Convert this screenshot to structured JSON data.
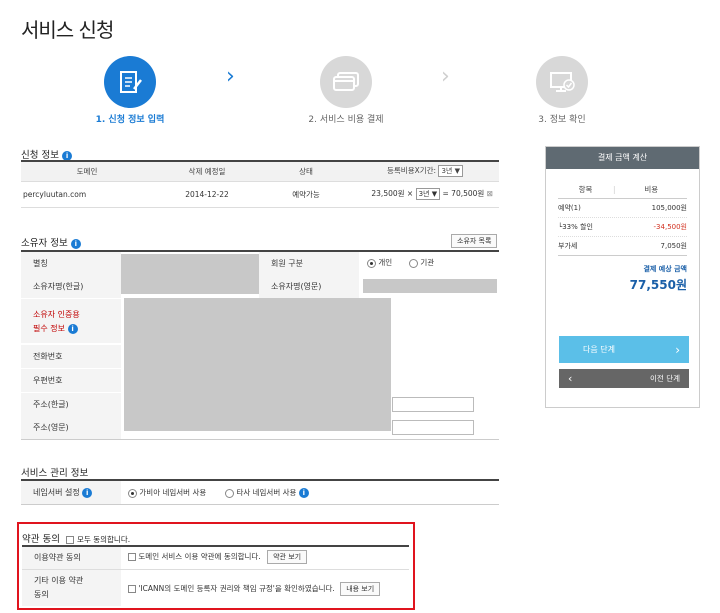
{
  "page": {
    "title": "서비스 신청"
  },
  "steps": [
    {
      "label": "1. 신청 정보 입력",
      "active": true
    },
    {
      "label": "2. 서비스 비용 결제",
      "active": false
    },
    {
      "label": "3. 정보 확인",
      "active": false
    }
  ],
  "application": {
    "title": "신청 정보",
    "headers": {
      "domain": "도메인",
      "deletion_date": "삭제 예정일",
      "status": "상태",
      "fee_period": "등록비용X기간:"
    },
    "header_period": "3년",
    "row": {
      "domain": "percyluutan.com",
      "deletion_date": "2014-12-22",
      "status": "예약가능",
      "unit_price": "23,500원 ×",
      "period": "3년",
      "total": "= 70,500원"
    }
  },
  "owner": {
    "title": "소유자 정보",
    "list_button": "소유자 목록",
    "labels": {
      "alias": "별칭",
      "member_type": "회원 구분",
      "name_kr": "소유자명(한글)",
      "name_en": "소유자명(영문)",
      "auth_line1": "소유자 인증용",
      "auth_line2": "필수 정보",
      "phone": "전화번호",
      "zip": "우편번호",
      "addr_kr": "주소(한글)",
      "addr_en": "주소(영문)"
    },
    "member_options": [
      "개인",
      "기관"
    ]
  },
  "service": {
    "title": "서비스 관리 정보",
    "nameserver_label": "네임서버 설정",
    "options": [
      "가비아 네임서버 사용",
      "타사 네임서버 사용"
    ]
  },
  "terms": {
    "title": "약관 동의",
    "agree_all": "모두 동의합니다.",
    "rows": [
      {
        "label": "이용약관 동의",
        "text": "도메인 서비스 이용 약관에 동의합니다.",
        "button": "약관 보기"
      },
      {
        "label_line1": "기타 이용 약관",
        "label_line2": "동의",
        "text": "'ICANN의 도메인 등록자 권리와 책임 규정'을 확인하였습니다.",
        "button": "내용 보기"
      }
    ]
  },
  "payment": {
    "title": "결제 금액 계산",
    "headers": {
      "item": "항목",
      "cost": "비용"
    },
    "rows": [
      {
        "item": "예약(1)",
        "cost": "105,000원"
      },
      {
        "item": "└33% 할인",
        "cost": "-34,500원"
      },
      {
        "item": "부가세",
        "cost": "7,050원"
      }
    ],
    "expected_label": "결제 예상 금액",
    "expected_amount": "77,550원",
    "next_button": "다음 단계",
    "prev_button": "이전 단계"
  },
  "colors": {
    "accent": "#1a7bd4",
    "red_highlight": "#e0141e",
    "discount": "#d2301f"
  }
}
